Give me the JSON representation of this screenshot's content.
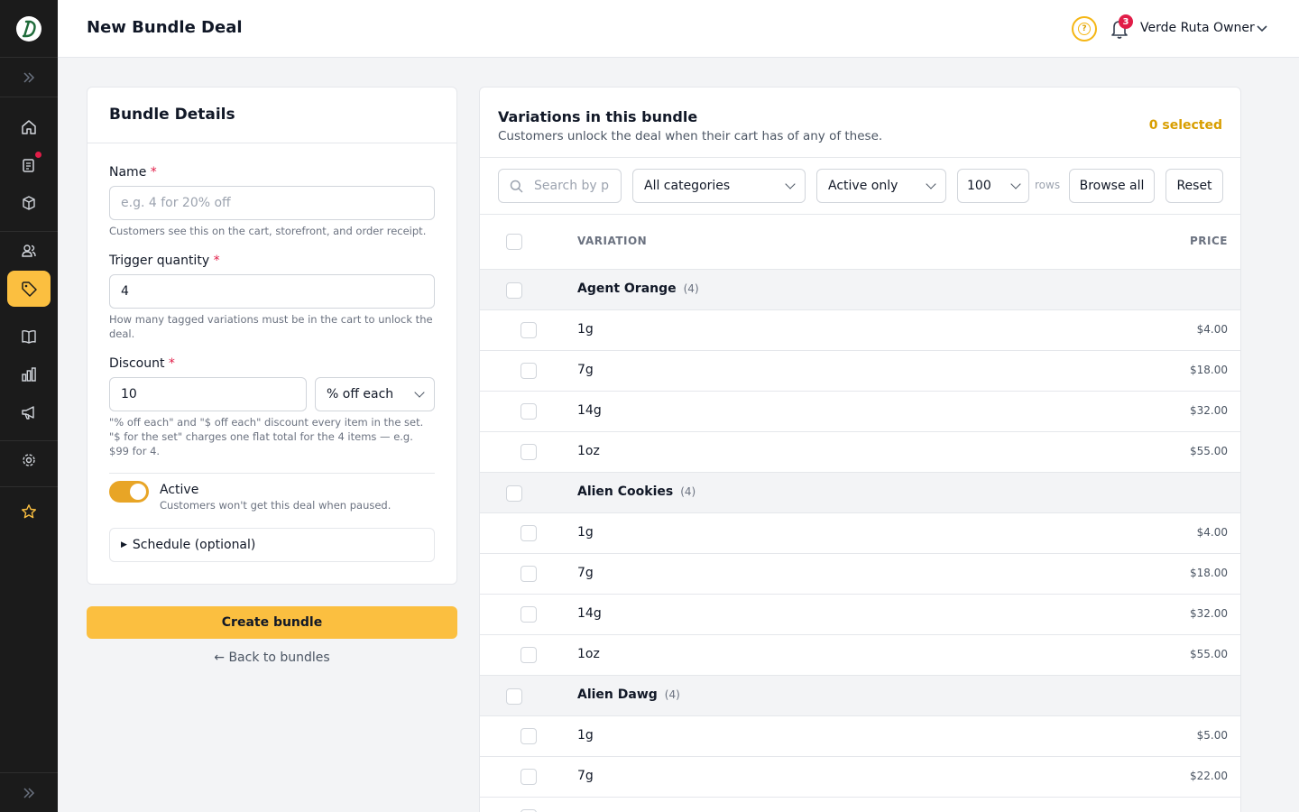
{
  "header": {
    "title": "New Bundle Deal",
    "notification_count": "3",
    "user_name": "Verde Ruta Owner"
  },
  "sidebar": {
    "items": [
      {
        "icon": "home-icon"
      },
      {
        "icon": "clipboard-icon",
        "has_dot": true
      },
      {
        "icon": "box-icon"
      },
      {
        "icon": "users-icon"
      },
      {
        "icon": "tag-icon",
        "active": true
      },
      {
        "icon": "map-icon"
      },
      {
        "icon": "bar-chart-icon"
      },
      {
        "icon": "megaphone-icon"
      },
      {
        "icon": "gear-icon"
      },
      {
        "icon": "star-icon"
      }
    ],
    "accent_color": "#fbbf40"
  },
  "details": {
    "title": "Bundle Details",
    "name_label": "Name",
    "name_placeholder": "e.g. 4 for 20% off",
    "name_help": "Customers see this on the cart, storefront, and order receipt.",
    "trigger_label": "Trigger quantity",
    "trigger_value": "4",
    "trigger_help": "How many tagged variations must be in the cart to unlock the deal.",
    "discount_label": "Discount",
    "discount_value": "10",
    "discount_type": "% off each",
    "discount_help": "\"% off each\" and \"$ off each\" discount every item in the set. \"$ for the set\" charges one flat total for the 4 items — e.g. $99 for 4.",
    "active_label": "Active",
    "active_on": true,
    "active_help": "Customers won't get this deal when paused.",
    "schedule_label": "Schedule (optional)",
    "required_mark": "*"
  },
  "actions": {
    "create_label": "Create bundle",
    "back_label": "← Back to bundles"
  },
  "variations": {
    "title": "Variations in this bundle",
    "subtitle": "Customers unlock the deal when their cart has of any of these.",
    "selected": "0 selected",
    "search_placeholder": "Search by p",
    "category_filter": "All categories",
    "status_filter": "Active only",
    "rows_value": "100",
    "rows_label": "rows",
    "browse_label": "Browse all",
    "reset_label": "Reset",
    "col_variation": "VARIATION",
    "col_price": "PRICE",
    "groups": [
      {
        "name": "Agent Orange",
        "count": "(4)",
        "items": [
          {
            "size": "1g",
            "price": "$4.00"
          },
          {
            "size": "7g",
            "price": "$18.00"
          },
          {
            "size": "14g",
            "price": "$32.00"
          },
          {
            "size": "1oz",
            "price": "$55.00"
          }
        ]
      },
      {
        "name": "Alien Cookies",
        "count": "(4)",
        "items": [
          {
            "size": "1g",
            "price": "$4.00"
          },
          {
            "size": "7g",
            "price": "$18.00"
          },
          {
            "size": "14g",
            "price": "$32.00"
          },
          {
            "size": "1oz",
            "price": "$55.00"
          }
        ]
      },
      {
        "name": "Alien Dawg",
        "count": "(4)",
        "items": [
          {
            "size": "1g",
            "price": "$5.00"
          },
          {
            "size": "7g",
            "price": "$22.00"
          }
        ]
      }
    ]
  }
}
